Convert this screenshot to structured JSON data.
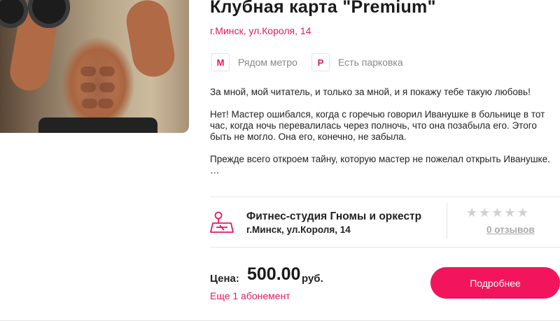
{
  "card": {
    "title": "Клубная карта \"Premium\"",
    "address": "г.Минск, ул.Короля, 14",
    "features": [
      {
        "icon": "metro-icon",
        "glyph": "M",
        "label": "Рядом метро"
      },
      {
        "icon": "parking-icon",
        "glyph": "P",
        "label": "Есть парковка"
      }
    ],
    "description": [
      "За мной, мой читатель, и только за мной, и я покажу тебе такую любовь!",
      "Нет! Мастер ошибался, когда с горечью говорил Иванушке в больнице в тот час, когда ночь перевалилась через полночь, что она позабыла его. Этого быть не могло. Она его, конечно, не забыла.",
      "Прежде всего откроем тайну, которую мастер не пожелал открыть Иванушке. …"
    ]
  },
  "club": {
    "icon": "map-location-icon",
    "name": "Фитнес-студия Гномы и оркестр",
    "address": "г.Минск, ул.Короля, 14",
    "rating": 0,
    "max_rating": 5,
    "reviews_label": "0 отзывов"
  },
  "pricing": {
    "price_label": "Цена:",
    "price": "500.00",
    "currency": "руб.",
    "more_link": "Еще 1 абонемент",
    "details_button": "Подробнее"
  },
  "colors": {
    "accent": "#e5195f",
    "button": "#f2155d"
  }
}
